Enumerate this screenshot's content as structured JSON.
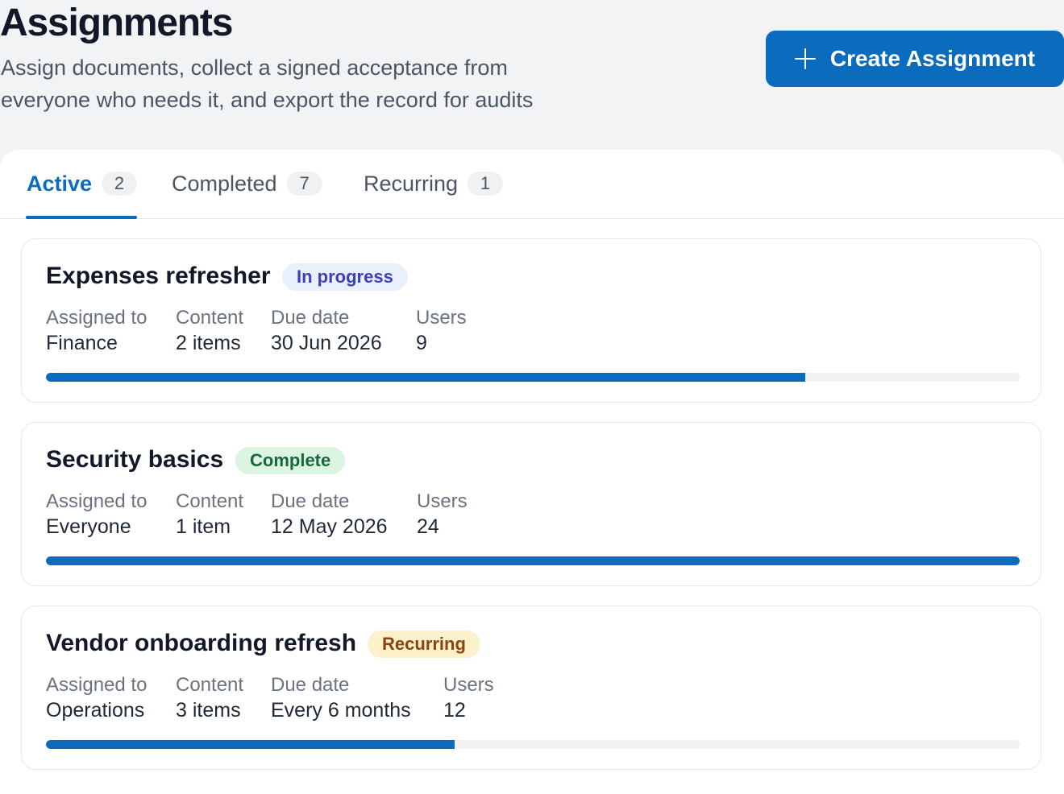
{
  "header": {
    "title": "Assignments",
    "subtitle": "Assign documents, collect a signed acceptance from everyone who needs it, and export the record for audits",
    "create_button_label": "Create Assignment",
    "create_button_icon": "plus-icon"
  },
  "colors": {
    "accent": "#0b6bbd",
    "in_progress_badge": "#3d3fb8",
    "complete_badge": "#17683a",
    "recurring_badge": "#8a4410"
  },
  "tabs": [
    {
      "label": "Active",
      "count": "2",
      "selected": true
    },
    {
      "label": "Completed",
      "count": "7",
      "selected": false
    },
    {
      "label": "Recurring",
      "count": "1",
      "selected": false
    }
  ],
  "field_labels": {
    "assigned_to": "Assigned to",
    "content": "Content",
    "due_date": "Due date",
    "users": "Users"
  },
  "assignments": [
    {
      "title": "Expenses refresher",
      "status": "In progress",
      "assigned_to": "Finance",
      "content": "2 items",
      "due_date": "30 Jun 2026",
      "users": "9",
      "progress": 0.78
    },
    {
      "title": "Security basics",
      "status": "Complete",
      "assigned_to": "Everyone",
      "content": "1 item",
      "due_date": "12 May 2026",
      "users": "24",
      "progress": 1.0
    },
    {
      "title": "Vendor onboarding refresh",
      "status": "Recurring",
      "assigned_to": "Operations",
      "content": "3 items",
      "due_date": "Every 6 months",
      "users": "12",
      "progress": 0.42
    }
  ]
}
